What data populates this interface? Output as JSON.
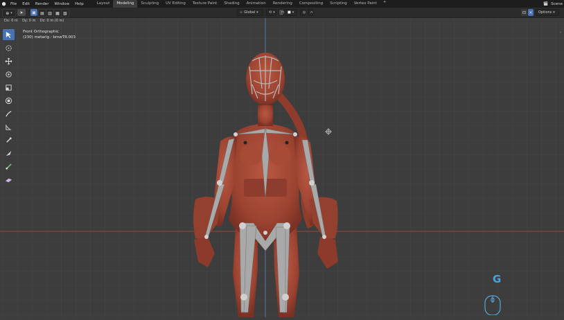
{
  "menubar": {
    "menus": [
      "File",
      "Edit",
      "Render",
      "Window",
      "Help"
    ],
    "workspaces": [
      "Layout",
      "Modeling",
      "Sculpting",
      "UV Editing",
      "Texture Paint",
      "Shading",
      "Animation",
      "Rendering",
      "Compositing",
      "Scripting",
      "Vertex Paint"
    ],
    "active_workspace": "Modeling",
    "add_tab": "+",
    "scene": "Scene"
  },
  "header": {
    "transform_orientation": "Global",
    "options_label": "Options"
  },
  "operator_info": "Dx: 0 m    Dy: 0 m    Dz: 0 m (0 m)",
  "viewport": {
    "view_name": "Front Orthographic",
    "object_info": "(230) metarig : bmwTR.003",
    "key_hint": "G"
  },
  "colors": {
    "accent": "#4772b3",
    "grid": "#474747",
    "x_axis": "#8e4a3a",
    "z_axis": "#4a74a6",
    "model": "#a34a38",
    "bones": "#a9a9a9"
  },
  "toolbar": {
    "tools": [
      "select-box-icon",
      "cursor-icon",
      "move-icon",
      "rotate-icon",
      "scale-icon",
      "transform-icon",
      "annotate-icon",
      "measure-icon",
      "bone-roll-icon",
      "bone-size-icon",
      "bone-envelope-icon",
      "extrude-icon",
      "shear-icon"
    ]
  }
}
